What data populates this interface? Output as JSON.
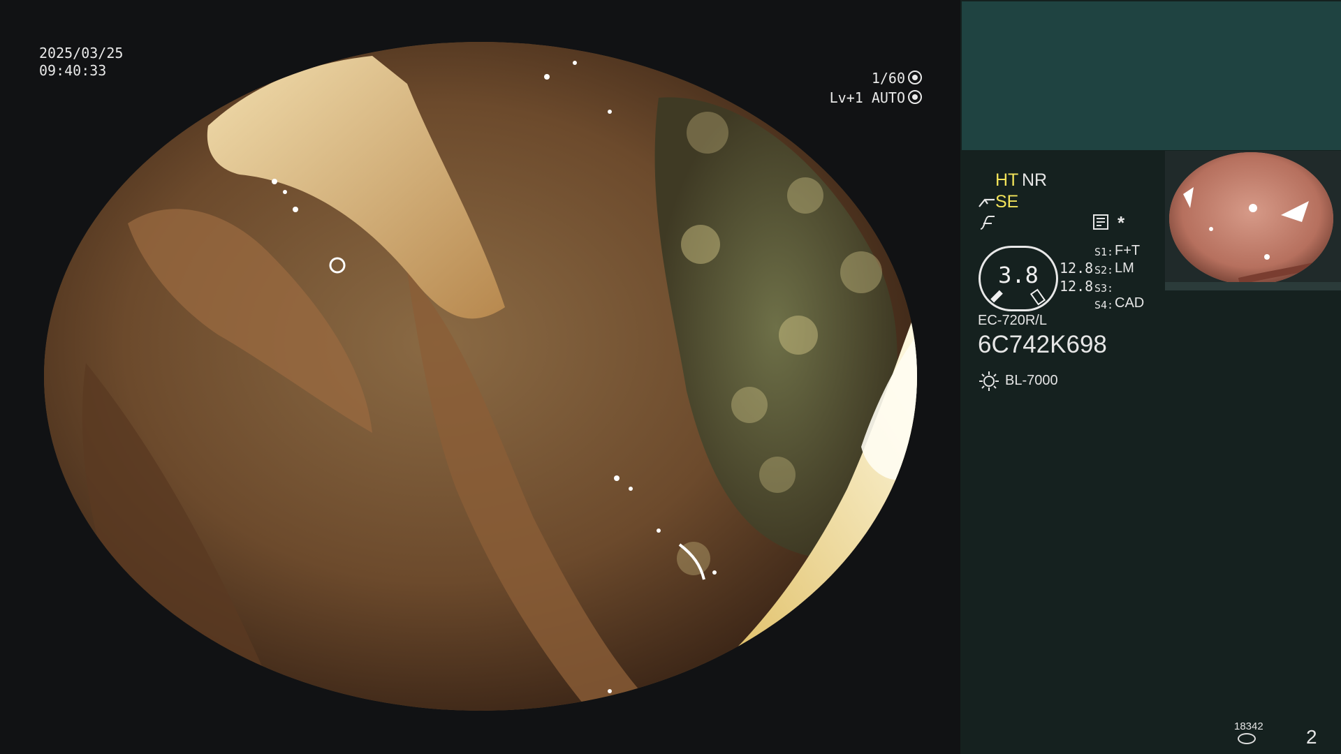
{
  "overlay": {
    "date": "2025/03/25",
    "time": "09:40:33",
    "shutter": "1/60",
    "level": "Lv+1 AUTO"
  },
  "panel": {
    "ht": "HT",
    "nr": "NR",
    "se": "SE",
    "gauge_value": "3.8",
    "gauge_right_top": "12.8",
    "gauge_right_bottom": "12.8",
    "s1": "S1:",
    "s1_val": "F+T",
    "s2": "S2:",
    "s2_val": "LM",
    "s3": "S3:",
    "s3_val": "",
    "s4": "S4:",
    "s4_val": "CAD",
    "scope_model": "EC-720R/L",
    "serial": "6C742K698",
    "light_source": "BL-7000",
    "counter": "18342",
    "page_number": "2"
  },
  "icons": {
    "shutter": "aperture-icon",
    "level": "auto-iris-icon",
    "scope": "scope-icon",
    "graph": "curve-icon",
    "memory": "memory-card-icon",
    "star": "asterisk-icon",
    "light": "light-source-icon",
    "counter": "counter-icon"
  },
  "colors": {
    "accent_yellow": "#f2e35a",
    "panel_bg": "#15211f",
    "panel_top": "#1f4341"
  }
}
